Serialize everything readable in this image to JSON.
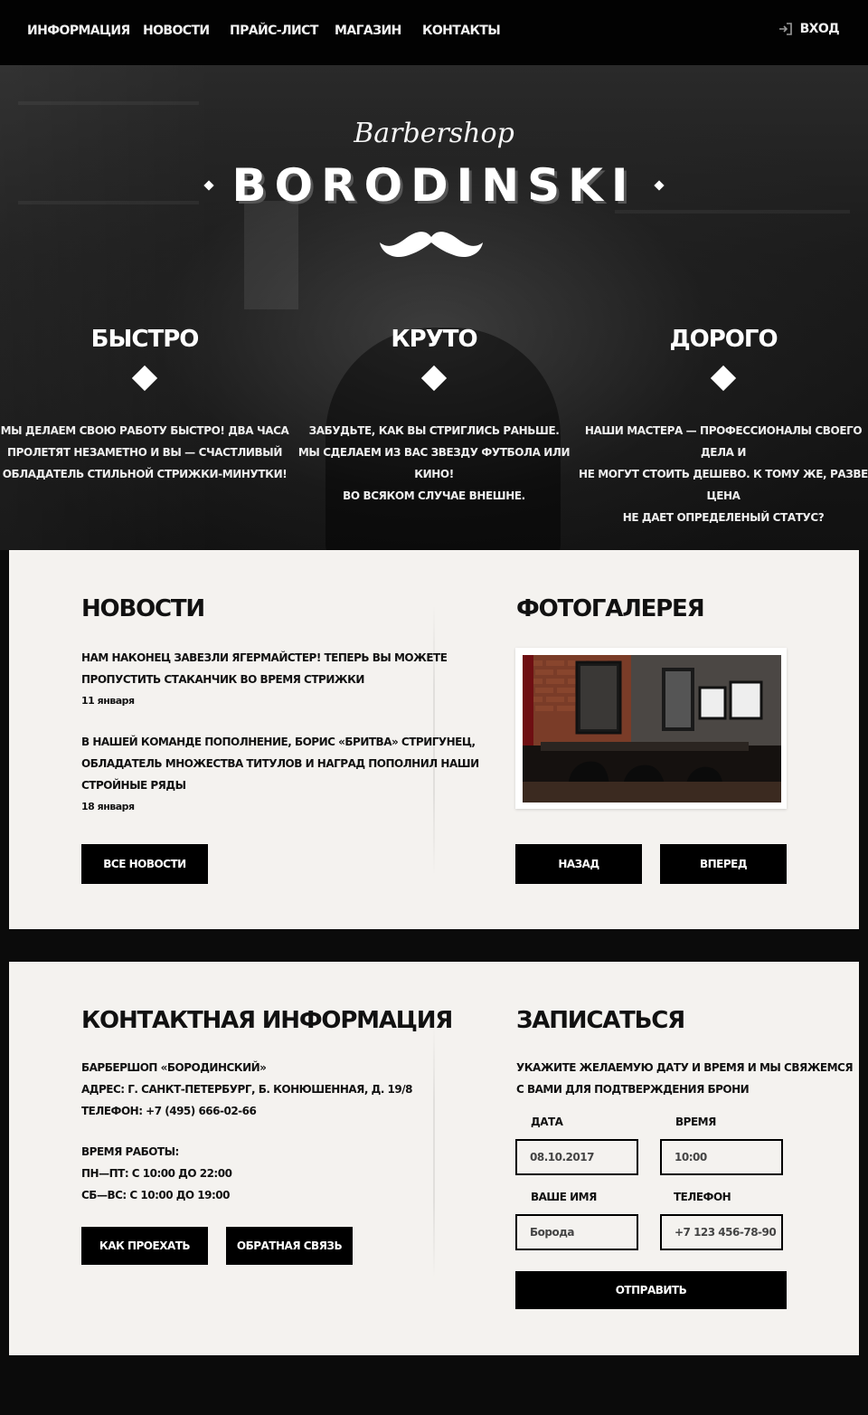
{
  "nav": {
    "items": [
      "ИНФОРМАЦИЯ",
      "НОВОСТИ",
      "ПРАЙС-ЛИСТ",
      "МАГАЗИН",
      "КОНТАКТЫ"
    ],
    "login_label": "ВХОД",
    "login_icon": "login-icon"
  },
  "hero": {
    "script_title": "Barbershop",
    "brand": "BORODINSKI",
    "features": [
      {
        "title": "БЫСТРО",
        "lines": [
          "МЫ ДЕЛАЕМ СВОЮ РАБОТУ БЫСТРО! ДВА ЧАСА",
          "ПРОЛЕТЯТ НЕЗАМЕТНО И ВЫ — СЧАСТЛИВЫЙ",
          "ОБЛАДАТЕЛЬ СТИЛЬНОЙ СТРИЖКИ-МИНУТКИ!"
        ]
      },
      {
        "title": "КРУТО",
        "lines": [
          "ЗАБУДЬТЕ, КАК ВЫ СТРИГЛИСЬ РАНЬШЕ.",
          "МЫ СДЕЛАЕМ ИЗ ВАС ЗВЕЗДУ ФУТБОЛА ИЛИ КИНО!",
          "ВО ВСЯКОМ СЛУЧАЕ ВНЕШНЕ."
        ]
      },
      {
        "title": "ДОРОГО",
        "lines": [
          "НАШИ МАСТЕРА — ПРОФЕССИОНАЛЫ СВОЕГО ДЕЛА И",
          "НЕ МОГУТ СТОИТЬ ДЕШЕВО. К ТОМУ ЖЕ, РАЗВЕ ЦЕНА",
          "НЕ ДАЕТ ОПРЕДЕЛЕНЫЙ СТАТУС?"
        ]
      }
    ]
  },
  "news": {
    "title": "НОВОСТИ",
    "items": [
      {
        "lines": [
          "НАМ НАКОНЕЦ ЗАВЕЗЛИ ЯГЕРМАЙСТЕР! ТЕПЕРЬ ВЫ МОЖЕТЕ",
          "ПРОПУСТИТЬ СТАКАНЧИК ВО ВРЕМЯ СТРИЖКИ"
        ],
        "date": "11 января"
      },
      {
        "lines": [
          "В НАШЕЙ КОМАНДЕ ПОПОЛНЕНИЕ, БОРИС «БРИТВА» СТРИГУНЕЦ,",
          "ОБЛАДАТЕЛЬ МНОЖЕСТВА ТИТУЛОВ И НАГРАД ПОПОЛНИЛ НАШИ",
          "СТРОЙНЫЕ РЯДЫ"
        ],
        "date": "18 января"
      }
    ],
    "all_button": "ВСЕ НОВОСТИ"
  },
  "gallery": {
    "title": "ФОТОГАЛЕРЕЯ",
    "prev_button": "НАЗАД",
    "next_button": "ВПЕРЕД"
  },
  "contacts": {
    "title": "КОНТАКТНАЯ ИНФОРМАЦИЯ",
    "lines": [
      "БАРБЕРШОП «БОРОДИНСКИЙ»",
      "АДРЕС: Г. САНКТ-ПЕТЕРБУРГ, Б. КОНЮШЕННАЯ, Д. 19/8",
      "ТЕЛЕФОН: +7 (495) 666-02-66"
    ],
    "hours_lines": [
      "ВРЕМЯ РАБОТЫ:",
      "ПН—ПТ: С 10:00 ДО 22:00",
      "СБ—ВС: С 10:00 ДО 19:00"
    ],
    "route_button": "КАК ПРОЕХАТЬ",
    "feedback_button": "ОБРАТНАЯ СВЯЗЬ"
  },
  "booking": {
    "title": "ЗАПИСАТЬСЯ",
    "intro_lines": [
      "УКАЖИТЕ ЖЕЛАЕМУЮ ДАТУ И ВРЕМЯ И МЫ СВЯЖЕМСЯ",
      "С ВАМИ ДЛЯ ПОДТВЕРЖДЕНИЯ БРОНИ"
    ],
    "date_label": "ДАТА",
    "date_value": "08.10.2017",
    "time_label": "ВРЕМЯ",
    "time_value": "10:00",
    "name_label": "ВАШЕ ИМЯ",
    "name_placeholder": "Борода",
    "phone_label": "ТЕЛЕФОН",
    "phone_placeholder": "+7 123 456-78-90",
    "submit_button": "ОТПРАВИТЬ"
  }
}
